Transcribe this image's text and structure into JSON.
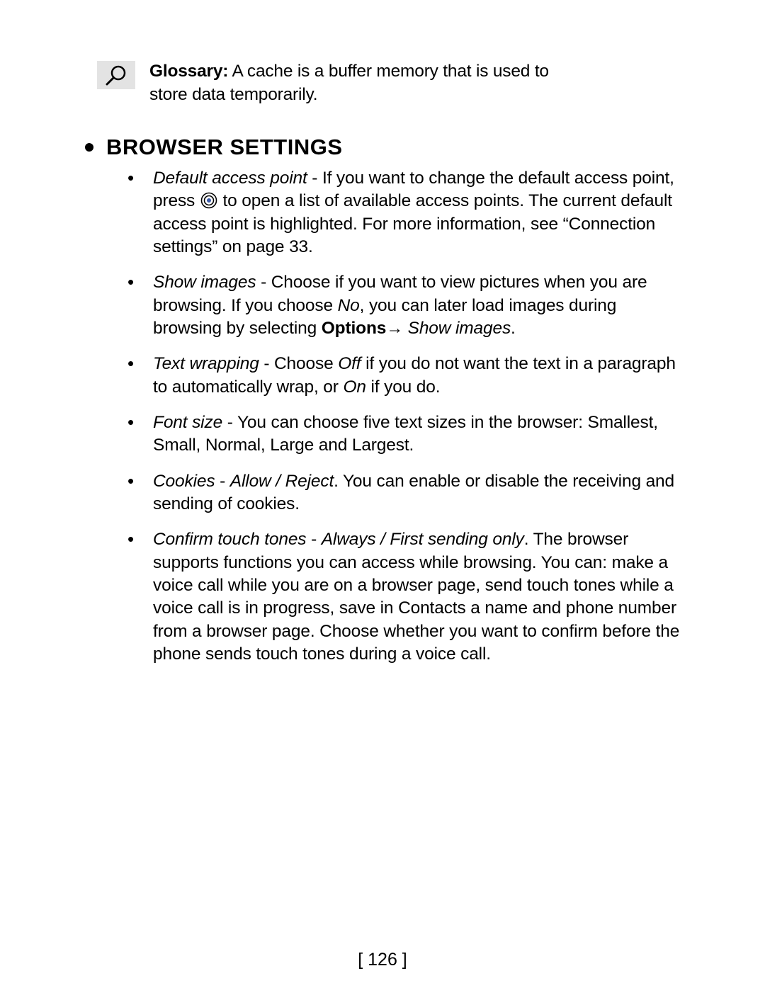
{
  "glossary": {
    "label": "Glossary:",
    "text": "A cache is a buffer memory that is used to store data temporarily."
  },
  "heading": "BROWSER SETTINGS",
  "items": {
    "default_access_point": {
      "term": "Default access point",
      "before": " - If you want to change the default access point, press ",
      "after": " to open a list of available access points. The current default access point is highlighted. For more information, see “Connection settings” on page 33."
    },
    "show_images": {
      "term": "Show images",
      "part1": " - Choose if you want to view pictures when you are browsing. If you choose ",
      "no": "No",
      "part2": ", you can later load images during browsing by selecting ",
      "options": "Options",
      "arrow": "→ ",
      "show_images_action": "Show images",
      "end": "."
    },
    "text_wrapping": {
      "term": "Text wrapping",
      "part1": " - Choose ",
      "off": "Off",
      "part2": "  if you do not want the text in a paragraph to automatically wrap, or ",
      "on": "On",
      "part3": " if you do."
    },
    "font_size": {
      "term": "Font size",
      "text": " - You can choose five text sizes in the browser: Smallest, Small, Normal, Large and Largest."
    },
    "cookies": {
      "term": "Cookies",
      "sep": " -  ",
      "values": "Allow / Reject",
      "text": ". You can enable or disable the receiving and sending of cookies."
    },
    "confirm_touch_tones": {
      "term": "Confirm touch tones",
      "sep": " -  ",
      "values": "Always /  First sending only",
      "text": ". The browser supports functions you can access while browsing. You can: make a voice call while you are on a browser page, send touch tones while a voice call is in progress, save in Contacts a name and phone number from a browser page. Choose whether you want to confirm before the phone sends touch tones during a voice call."
    }
  },
  "page_number": "[ 126 ]"
}
